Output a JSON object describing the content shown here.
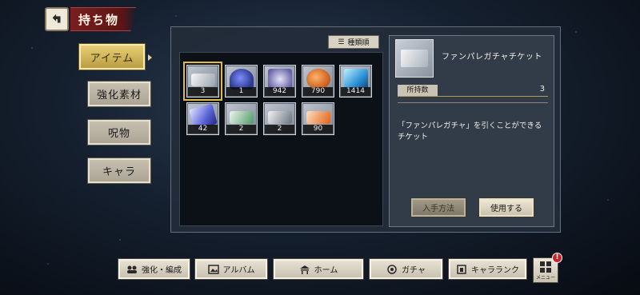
{
  "header": {
    "title": "持ち物"
  },
  "tabs": [
    {
      "label": "アイテム",
      "active": true
    },
    {
      "label": "強化素材",
      "active": false
    },
    {
      "label": "呪物",
      "active": false
    },
    {
      "label": "キャラ",
      "active": false
    }
  ],
  "sort": {
    "icon": "sort-icon",
    "label": "種類順"
  },
  "items": [
    {
      "name": "fanpare-gacha-ticket",
      "count": "3",
      "selected": true
    },
    {
      "name": "blue-charm",
      "count": "1"
    },
    {
      "name": "dice-pouch",
      "count": "942"
    },
    {
      "name": "orange-leaves",
      "count": "790"
    },
    {
      "name": "blue-crystal",
      "count": "1414"
    },
    {
      "name": "purple-gem",
      "count": "42"
    },
    {
      "name": "green-ticket",
      "count": "2"
    },
    {
      "name": "silver-ticket",
      "count": "2"
    },
    {
      "name": "orange-ticket",
      "count": "90"
    }
  ],
  "detail": {
    "name": "ファンパレガチャチケット",
    "owned_label": "所持数",
    "owned_value": "3",
    "description": "「ファンパレガチャ」を引くことができるチケット",
    "how_to_get": "入手方法",
    "use": "使用する"
  },
  "bottom_nav": [
    {
      "label": "強化・編成",
      "icon": "team-icon"
    },
    {
      "label": "アルバム",
      "icon": "album-icon"
    },
    {
      "label": "ホーム",
      "icon": "home-icon"
    },
    {
      "label": "ガチャ",
      "icon": "gacha-icon"
    },
    {
      "label": "キャラランク",
      "icon": "rank-icon"
    }
  ],
  "menu": {
    "label": "メニュー",
    "badge": "!"
  },
  "colors": {
    "accent_gold": "#e0b94a",
    "title_red": "#7a1f1f",
    "alert_red": "#c8242a"
  }
}
